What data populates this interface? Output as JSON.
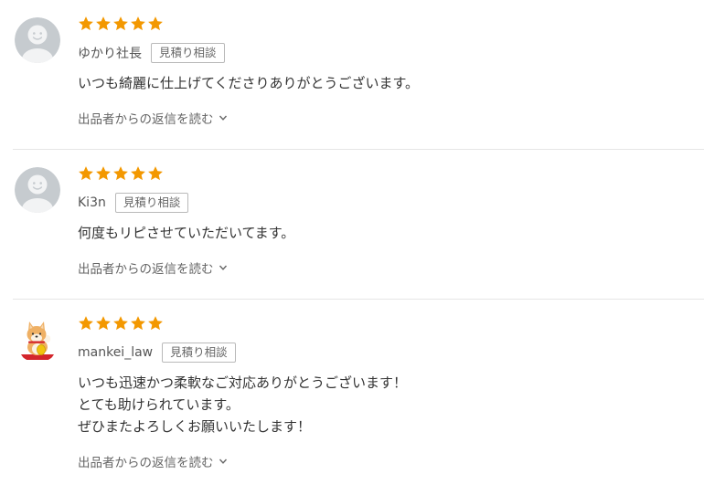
{
  "colors": {
    "star": "#f39800",
    "divider": "#e6e6e6",
    "avatar_default": "#c6cbcf"
  },
  "reviews": [
    {
      "username": "ゆかり社長",
      "badge": "見積り相談",
      "rating": 5,
      "avatar_icon": "default-user-icon",
      "comment_lines": [
        "いつも綺麗に仕上げてくださりありがとうございます。"
      ],
      "reply_link": "出品者からの返信を読む"
    },
    {
      "username": "Ki3n",
      "badge": "見積り相談",
      "rating": 5,
      "avatar_icon": "default-user-icon",
      "comment_lines": [
        "何度もリピさせていただいてます。"
      ],
      "reply_link": "出品者からの返信を読む"
    },
    {
      "username": "mankei_law",
      "badge": "見積り相談",
      "rating": 5,
      "avatar_icon": "shiba-inu-lucky-cat-icon",
      "comment_lines": [
        "いつも迅速かつ柔軟なご対応ありがとうございます！",
        "とても助けられています。",
        "ぜひまたよろしくお願いいたします！"
      ],
      "reply_link": "出品者からの返信を読む"
    }
  ]
}
